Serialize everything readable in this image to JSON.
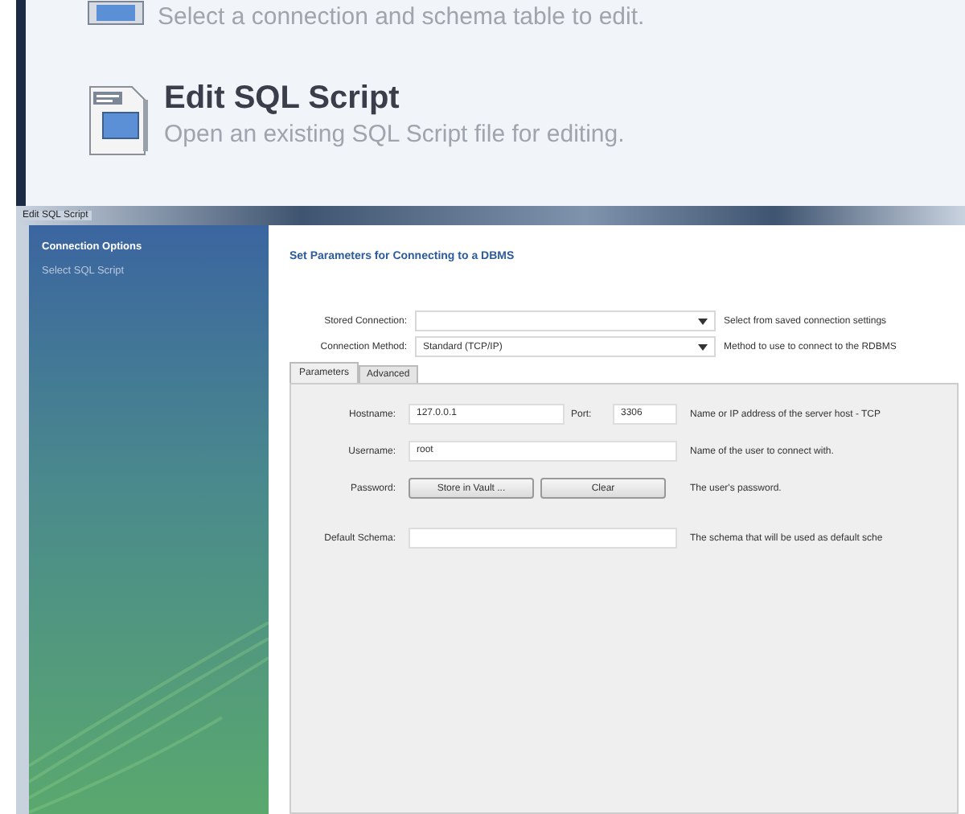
{
  "start_items": [
    {
      "description": "Select a connection and schema table to edit."
    },
    {
      "title": "Edit SQL Script",
      "description": "Open an existing SQL Script file for editing."
    }
  ],
  "dialog": {
    "title": "Edit SQL Script",
    "steps": [
      {
        "label": "Connection Options",
        "selected": true
      },
      {
        "label": "Select SQL Script",
        "selected": false
      }
    ],
    "heading": "Set Parameters for Connecting to a DBMS",
    "selects": [
      {
        "label": "Stored Connection:",
        "hint": "Select from saved connection settings"
      },
      {
        "label": "Connection Method:",
        "value": "Standard (TCP/IP)",
        "hint": "Method to use to connect to the RDBMS"
      }
    ],
    "tabs": [
      {
        "label": "Parameters",
        "selected": true
      },
      {
        "label": "Advanced",
        "selected": false
      }
    ],
    "rows": [
      {
        "kind": "host",
        "label": "Hostname:",
        "value": "127.0.0.1",
        "port_label": "Port:",
        "port_value": "3306",
        "hint": "Name or IP address of the server host - TCP"
      },
      {
        "kind": "text",
        "label": "Username:",
        "value": "root",
        "hint": "Name of the user to connect with."
      },
      {
        "kind": "buttons",
        "label": "Password:",
        "buttons": [
          "Store in Vault ...",
          "Clear"
        ],
        "hint": "The user's password."
      },
      {
        "kind": "text",
        "label": "Default Schema:",
        "hint": "The schema that will be used as default sche"
      }
    ]
  }
}
